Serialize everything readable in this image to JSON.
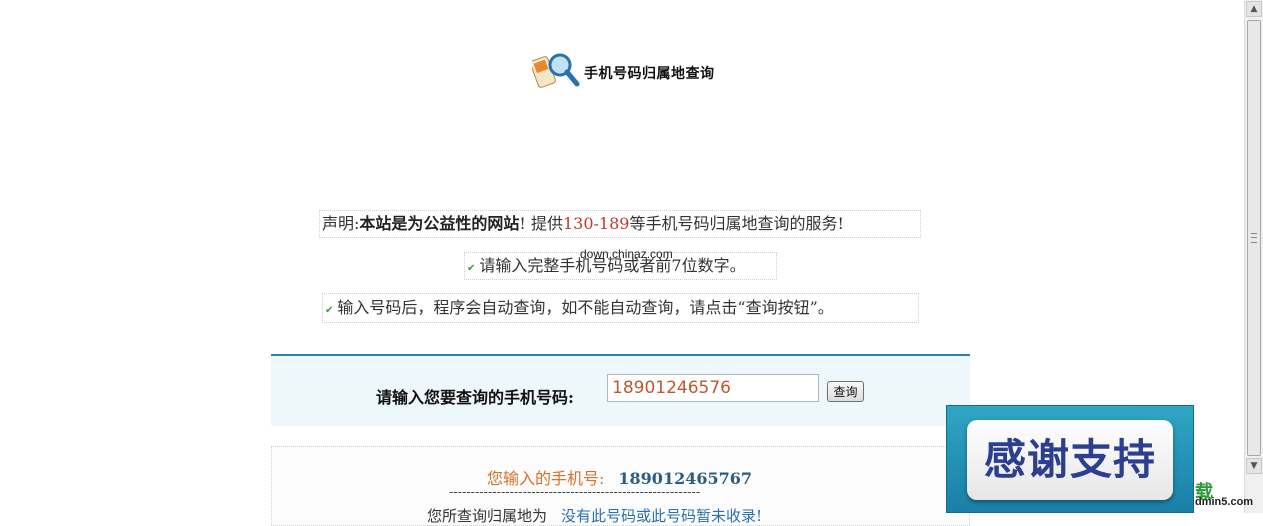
{
  "header": {
    "title": "手机号码归属地查询"
  },
  "notices": {
    "statement_prefix": "声明:",
    "statement_bold": "本站是为公益性的网站",
    "statement_mid": "! 提供",
    "statement_range": "130-189",
    "statement_suffix": "等手机号码归属地查询的服务!",
    "hint_digits": "请输入完整手机号码或者前7位数字。",
    "hint_auto": "输入号码后，程序会自动查询，如不能自动查询，请点击“查询按钮”。"
  },
  "watermark": "down.chinaz.com",
  "query": {
    "label": "请输入您要查询的手机号码:",
    "input_value": "18901246576",
    "button_label": "查询"
  },
  "result": {
    "label": "您输入的手机号:",
    "number": "189012465767",
    "divider": "----------------------------------------------------------",
    "partial_prefix": "您所查询归属地为",
    "partial_link": "没有此号码或此号码暂未收录!"
  },
  "banner": {
    "text": "感谢支持",
    "side_text": "载",
    "side_domain": "dmin5.com"
  }
}
